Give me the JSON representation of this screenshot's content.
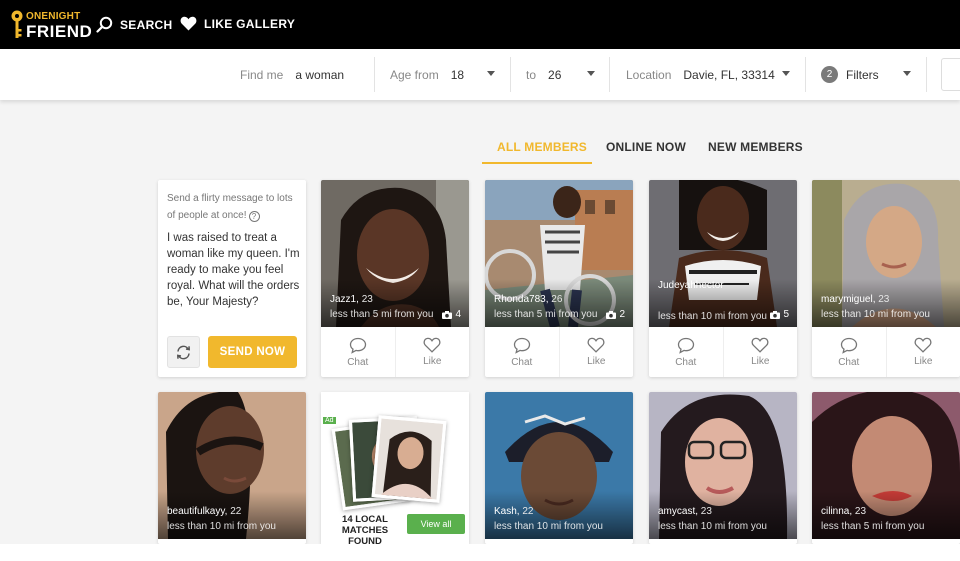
{
  "brand": {
    "line1": "ONENIGHT",
    "line2": "FRIEND",
    "accent": "#f1b82d"
  },
  "nav": {
    "search_label": "SEARCH",
    "like_gallery_label": "LIKE GALLERY"
  },
  "filters": {
    "find_label": "Find me",
    "find_value": "a woman",
    "age_from_label": "Age from",
    "age_from_value": "18",
    "age_to_label": "to",
    "age_to_value": "26",
    "location_label": "Location",
    "location_value": "Davie, FL, 33314",
    "filters_count": "2",
    "filters_label": "Filters"
  },
  "tabs": [
    {
      "label": "ALL MEMBERS",
      "active": true
    },
    {
      "label": "ONLINE NOW",
      "active": false
    },
    {
      "label": "NEW MEMBERS",
      "active": false
    }
  ],
  "message_card": {
    "hint": "Send a flirty message to lots of people at once!",
    "help_icon": "?",
    "text": "I was raised to treat a woman like my queen. I'm ready to make you feel royal. What will the orders be, Your Majesty?",
    "send_label": "SEND NOW",
    "refresh_icon": "refresh-icon"
  },
  "actions": {
    "chat_label": "Chat",
    "like_label": "Like"
  },
  "members": [
    {
      "name": "Jazz1",
      "age": "23",
      "distance": "less than 5 mi from you",
      "photos": "4"
    },
    {
      "name": "Rhonda783",
      "age": "26",
      "distance": "less than 5 mi from you",
      "photos": "2"
    },
    {
      "name": "Judeyahhector",
      "age": "",
      "distance": "less than 10 mi from you",
      "photos": "5"
    },
    {
      "name": "marymiguel",
      "age": "23",
      "distance": "less than 10 mi from you",
      "photos": ""
    },
    {
      "name": "beautifulkayy",
      "age": "22",
      "distance": "less than 10 mi from you",
      "photos": ""
    },
    {
      "name": "Kash",
      "age": "22",
      "distance": "less than 10 mi from you",
      "photos": ""
    },
    {
      "name": "amycast",
      "age": "23",
      "distance": "less than 10 mi from you",
      "photos": ""
    },
    {
      "name": "cilinna",
      "age": "23",
      "distance": "less than 5 mi from you",
      "photos": ""
    }
  ],
  "ad": {
    "tag": "Ad",
    "caption": "14 LOCAL MATCHES FOUND",
    "button": "View all"
  }
}
